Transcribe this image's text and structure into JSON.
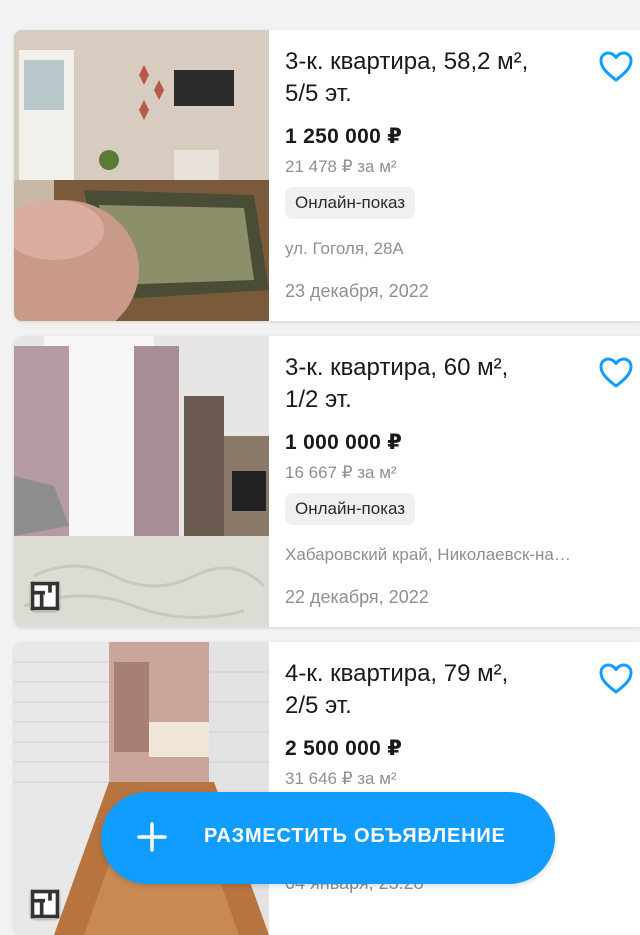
{
  "colors": {
    "accent": "#119dff",
    "text_primary": "#1a1a1a",
    "text_secondary": "#8f8f8f",
    "badge_bg": "#f0f0f0"
  },
  "listings": [
    {
      "title": "3-к. квартира, 58,2 м²,\n5/5 эт.",
      "price": "1 250 000 ₽",
      "price_per_m": "21 478 ₽ за м²",
      "badge": "Онлайн-показ",
      "address": "ул. Гоголя, 28А",
      "date": "23 декабря, 2022",
      "favorite_icon": "heart-outline-icon",
      "has_plan_badge": false
    },
    {
      "title": "3-к. квартира, 60 м²,\n1/2 эт.",
      "price": "1 000 000 ₽",
      "price_per_m": "16 667 ₽ за м²",
      "badge": "Онлайн-показ",
      "address": "Хабаровский край, Николаевск-на…",
      "date": "22 декабря, 2022",
      "favorite_icon": "heart-outline-icon",
      "has_plan_badge": true
    },
    {
      "title": "4-к. квартира, 79 м²,\n2/5 эт.",
      "price": "2 500 000 ₽",
      "price_per_m": "31 646 ₽ за м²",
      "date": "04 января, 23:28",
      "favorite_icon": "heart-outline-icon",
      "has_plan_badge": true
    }
  ],
  "fab": {
    "label": "РАЗМЕСТИТЬ ОБЪЯВЛЕНИЕ",
    "icon": "plus-icon"
  }
}
